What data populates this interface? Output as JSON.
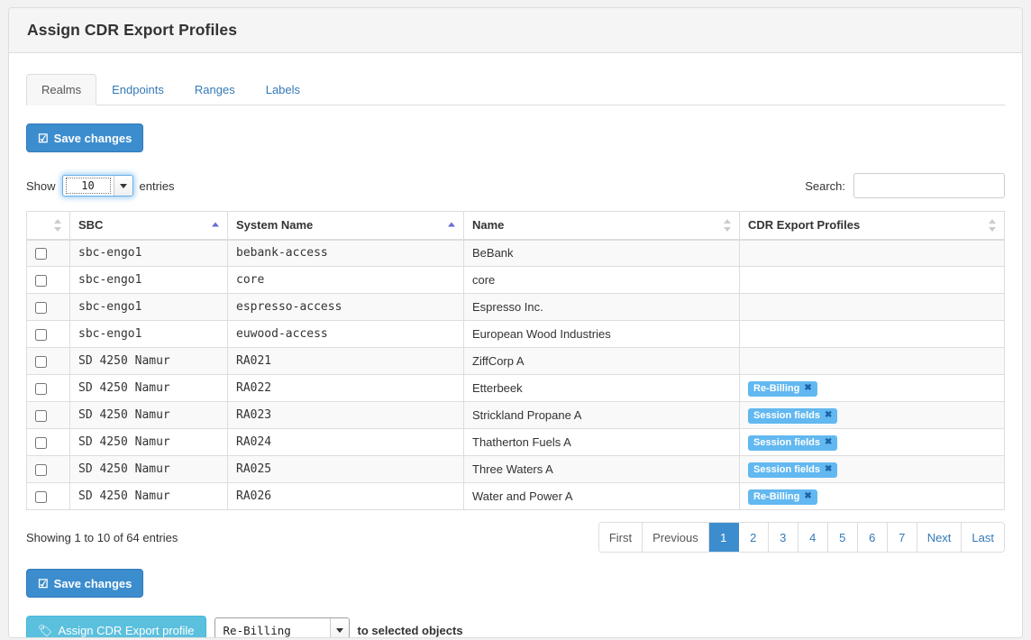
{
  "panel": {
    "title": "Assign CDR Export Profiles"
  },
  "tabs": [
    {
      "label": "Realms",
      "active": true
    },
    {
      "label": "Endpoints",
      "active": false
    },
    {
      "label": "Ranges",
      "active": false
    },
    {
      "label": "Labels",
      "active": false
    }
  ],
  "toolbar": {
    "save_label": "Save changes",
    "save_icon": "checkbox-checked-icon"
  },
  "controls": {
    "show_label": "Show",
    "entries_label": "entries",
    "page_length": "10",
    "search_label": "Search:",
    "search_value": "",
    "search_placeholder": ""
  },
  "table": {
    "columns": [
      {
        "label": "",
        "sort": "none"
      },
      {
        "label": "SBC",
        "sort": "asc"
      },
      {
        "label": "System Name",
        "sort": "asc"
      },
      {
        "label": "Name",
        "sort": "none"
      },
      {
        "label": "CDR Export Profiles",
        "sort": "none"
      }
    ],
    "rows": [
      {
        "checked": false,
        "sbc": "sbc-engo1",
        "system_name": "bebank-access",
        "name": "BeBank",
        "profiles": []
      },
      {
        "checked": false,
        "sbc": "sbc-engo1",
        "system_name": "core",
        "name": "core",
        "profiles": []
      },
      {
        "checked": false,
        "sbc": "sbc-engo1",
        "system_name": "espresso-access",
        "name": "Espresso Inc.",
        "profiles": []
      },
      {
        "checked": false,
        "sbc": "sbc-engo1",
        "system_name": "euwood-access",
        "name": "European Wood Industries",
        "profiles": []
      },
      {
        "checked": false,
        "sbc": "SD 4250 Namur",
        "system_name": "RA021",
        "name": "ZiffCorp A",
        "profiles": []
      },
      {
        "checked": false,
        "sbc": "SD 4250 Namur",
        "system_name": "RA022",
        "name": "Etterbeek",
        "profiles": [
          "Re-Billing"
        ]
      },
      {
        "checked": false,
        "sbc": "SD 4250 Namur",
        "system_name": "RA023",
        "name": "Strickland Propane A",
        "profiles": [
          "Session fields"
        ]
      },
      {
        "checked": false,
        "sbc": "SD 4250 Namur",
        "system_name": "RA024",
        "name": "Thatherton Fuels A",
        "profiles": [
          "Session fields"
        ]
      },
      {
        "checked": false,
        "sbc": "SD 4250 Namur",
        "system_name": "RA025",
        "name": "Three Waters A",
        "profiles": [
          "Session fields"
        ]
      },
      {
        "checked": false,
        "sbc": "SD 4250 Namur",
        "system_name": "RA026",
        "name": "Water and Power A",
        "profiles": [
          "Re-Billing"
        ]
      }
    ],
    "tag_remove_glyph": "✖"
  },
  "footer": {
    "info": "Showing 1 to 10 of 64 entries",
    "pagination": [
      {
        "label": "First",
        "state": "disabled"
      },
      {
        "label": "Previous",
        "state": "disabled"
      },
      {
        "label": "1",
        "state": "active"
      },
      {
        "label": "2",
        "state": "normal"
      },
      {
        "label": "3",
        "state": "normal"
      },
      {
        "label": "4",
        "state": "normal"
      },
      {
        "label": "5",
        "state": "normal"
      },
      {
        "label": "6",
        "state": "normal"
      },
      {
        "label": "7",
        "state": "normal"
      },
      {
        "label": "Next",
        "state": "normal"
      },
      {
        "label": "Last",
        "state": "normal"
      }
    ]
  },
  "bottom": {
    "save_label": "Save changes",
    "save_icon": "checkbox-checked-icon",
    "assign_label": "Assign CDR Export profile",
    "assign_icon": "tag-icon",
    "assign_selected": "Re-Billing",
    "assign_tail": "to selected objects"
  },
  "colors": {
    "primary": "#3c8dce",
    "info": "#5bc0de",
    "tag": "#62b8f0",
    "tag_x": "#1c63a8",
    "link": "#337ab7",
    "sort_active": "#6b6bd6",
    "border": "#dddddd"
  }
}
